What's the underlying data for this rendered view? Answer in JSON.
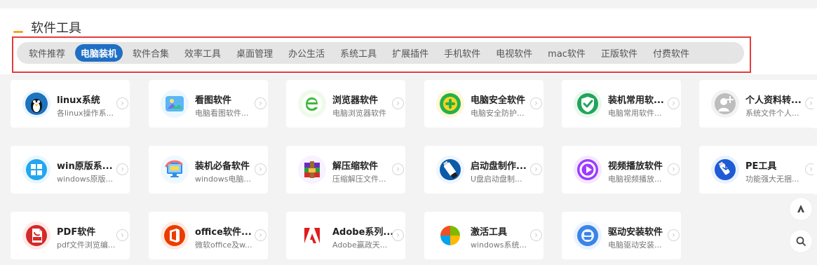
{
  "section": {
    "title": "软件工具"
  },
  "tabs": [
    {
      "label": "软件推荐"
    },
    {
      "label": "电脑装机"
    },
    {
      "label": "软件合集"
    },
    {
      "label": "效率工具"
    },
    {
      "label": "桌面管理"
    },
    {
      "label": "办公生活"
    },
    {
      "label": "系统工具"
    },
    {
      "label": "扩展插件"
    },
    {
      "label": "手机软件"
    },
    {
      "label": "电视软件"
    },
    {
      "label": "mac软件"
    },
    {
      "label": "正版软件"
    },
    {
      "label": "付费软件"
    }
  ],
  "active_tab": "电脑装机",
  "cards": [
    {
      "title": "linux系统",
      "subtitle": "各linux操作系...",
      "icon": "linux-penguin-icon"
    },
    {
      "title": "看图软件",
      "subtitle": "电脑看图软件...",
      "icon": "image-viewer-icon"
    },
    {
      "title": "浏览器软件",
      "subtitle": "电脑浏览器软件",
      "icon": "browser-e-icon"
    },
    {
      "title": "电脑安全软件",
      "subtitle": "电脑安全防护...",
      "icon": "security-plus-icon"
    },
    {
      "title": "装机常用软...",
      "subtitle": "电脑常用软件...",
      "icon": "shield-check-icon"
    },
    {
      "title": "个人资料转...",
      "subtitle": "系统文件个人...",
      "icon": "profile-transfer-icon"
    },
    {
      "title": "win原版系...",
      "subtitle": "windows原版...",
      "icon": "windows-icon"
    },
    {
      "title": "装机必备软件",
      "subtitle": "windows电脑...",
      "icon": "computer-setup-icon"
    },
    {
      "title": "解压缩软件",
      "subtitle": "压缩解压文件...",
      "icon": "archive-books-icon"
    },
    {
      "title": "启动盘制作...",
      "subtitle": "U盘启动盘制...",
      "icon": "usb-boot-icon"
    },
    {
      "title": "视频播放软件",
      "subtitle": "电脑视频播放...",
      "icon": "video-play-icon"
    },
    {
      "title": "PE工具",
      "subtitle": "功能强大无捆...",
      "icon": "pe-usb-icon"
    },
    {
      "title": "PDF软件",
      "subtitle": "pdf文件浏览编...",
      "icon": "pdf-icon"
    },
    {
      "title": "office软件...",
      "subtitle": "微软office及w...",
      "icon": "office-icon"
    },
    {
      "title": "Adobe系列...",
      "subtitle": "Adobe赢政天...",
      "icon": "adobe-icon"
    },
    {
      "title": "激活工具",
      "subtitle": "windows系统...",
      "icon": "activation-windows-icon"
    },
    {
      "title": "驱动安装软件",
      "subtitle": "电脑驱动安装...",
      "icon": "driver-install-icon"
    }
  ],
  "colors": {
    "accent": "#1f6fc4",
    "highlight_border": "#e53b3b",
    "tab_bar": "#e5e5e5",
    "page_background": "#f3f3f3"
  },
  "floating_controls": [
    {
      "icon": "up-arrow-icon"
    },
    {
      "icon": "search-icon"
    }
  ]
}
